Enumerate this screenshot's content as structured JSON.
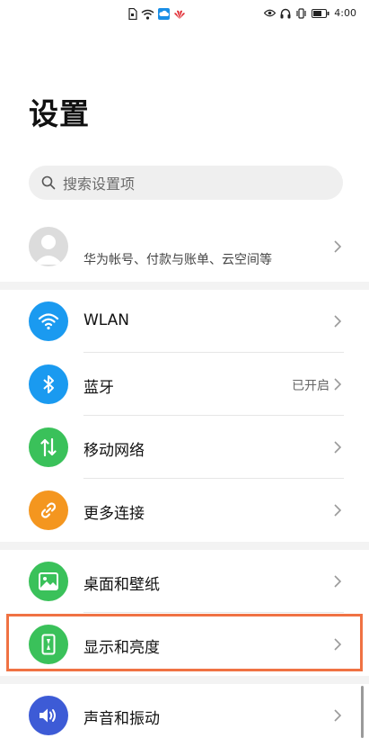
{
  "status_bar": {
    "time": "4:00",
    "left_icons": [
      "sim-icon",
      "wifi-icon",
      "cloud-icon",
      "huawei-logo-icon"
    ],
    "right_icons": [
      "eye-icon",
      "headphone-icon",
      "vibrate-icon",
      "battery-icon"
    ]
  },
  "page": {
    "title": "设置"
  },
  "search": {
    "placeholder": "搜索设置项"
  },
  "account": {
    "subtitle": "华为帐号、付款与账单、云空间等"
  },
  "settings": [
    {
      "key": "wlan",
      "label": "WLAN",
      "value": "",
      "icon": "wifi-icon",
      "color": "#1a9af0"
    },
    {
      "key": "bluetooth",
      "label": "蓝牙",
      "value": "已开启",
      "icon": "bluetooth-icon",
      "color": "#1a9af0"
    },
    {
      "key": "mobile-network",
      "label": "移动网络",
      "value": "",
      "icon": "mobile-data-icon",
      "color": "#3ac15a"
    },
    {
      "key": "more-connections",
      "label": "更多连接",
      "value": "",
      "icon": "link-icon",
      "color": "#f4961f"
    },
    {
      "key": "home-wallpaper",
      "label": "桌面和壁纸",
      "value": "",
      "icon": "picture-icon",
      "color": "#3ac15a"
    },
    {
      "key": "display-brightness",
      "label": "显示和亮度",
      "value": "",
      "icon": "display-icon",
      "color": "#3ac15a"
    },
    {
      "key": "sound-vibration",
      "label": "声音和振动",
      "value": "",
      "icon": "speaker-icon",
      "color": "#3d5bd6"
    }
  ],
  "highlight_color": "#f07243"
}
